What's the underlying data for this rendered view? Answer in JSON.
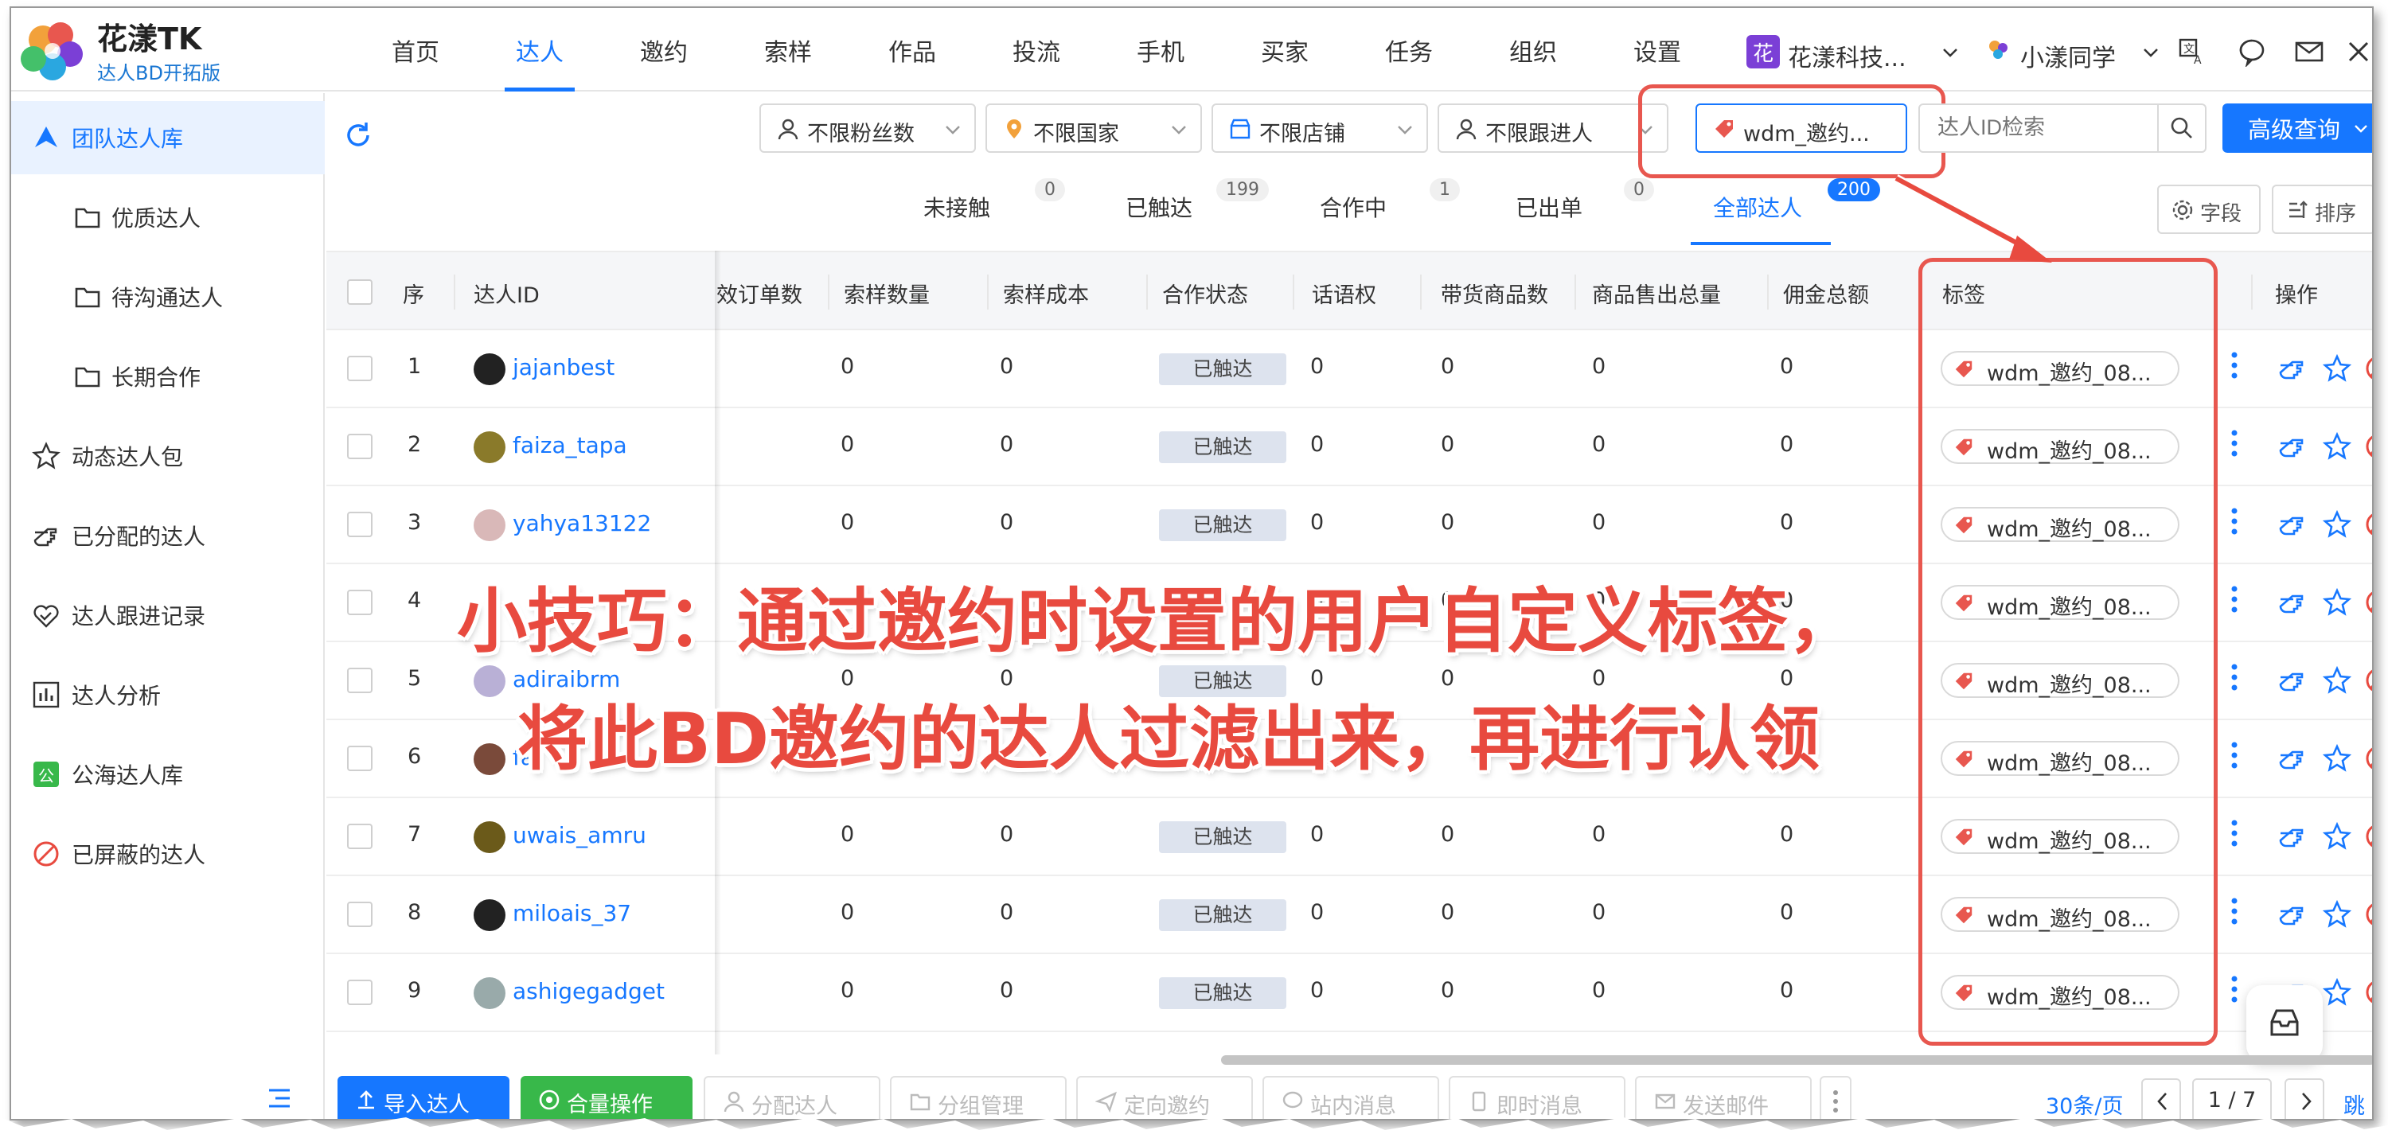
{
  "app": {
    "name": "花漾TK",
    "subtitle": "达人BD开拓版"
  },
  "nav": {
    "items": [
      "首页",
      "达人",
      "邀约",
      "索样",
      "作品",
      "投流",
      "手机",
      "买家",
      "任务",
      "组织",
      "设置"
    ],
    "active": "达人",
    "org_badge": "花",
    "org_name": "花漾科技...",
    "user_name": "小漾同学"
  },
  "sidebar": {
    "items": [
      {
        "label": "团队达人库",
        "icon": "team-library-icon",
        "active": true
      },
      {
        "label": "优质达人",
        "icon": "folder-icon",
        "active": false
      },
      {
        "label": "待沟通达人",
        "icon": "folder-icon",
        "active": false
      },
      {
        "label": "长期合作",
        "icon": "folder-icon",
        "active": false
      },
      {
        "label": "动态达人包",
        "icon": "star-icon",
        "active": false
      },
      {
        "label": "已分配的达人",
        "icon": "hand-point-icon",
        "active": false
      },
      {
        "label": "达人跟进记录",
        "icon": "heart-handshake-icon",
        "active": false
      },
      {
        "label": "达人分析",
        "icon": "bar-chart-icon",
        "active": false
      },
      {
        "label": "公海达人库",
        "icon": "public-pool-icon",
        "active": false
      },
      {
        "label": "已屏蔽的达人",
        "icon": "block-icon",
        "active": false
      }
    ]
  },
  "filters": {
    "followers": "不限粉丝数",
    "country": "不限国家",
    "shop": "不限店铺",
    "follower_person": "不限跟进人",
    "tag": "wdm_邀约...",
    "search_placeholder": "达人ID检索",
    "advanced": "高级查询"
  },
  "status_tabs": [
    {
      "label": "未接触",
      "count": "0"
    },
    {
      "label": "已触达",
      "count": "199"
    },
    {
      "label": "合作中",
      "count": "1"
    },
    {
      "label": "已出单",
      "count": "0"
    },
    {
      "label": "全部达人",
      "count": "200",
      "active": true
    }
  ],
  "view_buttons": {
    "fields": "字段",
    "sort": "排序"
  },
  "table": {
    "headers": {
      "seq": "序",
      "id": "达人ID",
      "orders": "效订单数",
      "sample_qty": "索样数量",
      "sample_cost": "索样成本",
      "coop_status": "合作状态",
      "influence": "话语权",
      "product_count": "带货商品数",
      "sales_total": "商品售出总量",
      "commission": "佣金总额",
      "tag": "标签",
      "ops": "操作"
    },
    "rows": [
      {
        "seq": "1",
        "id": "jajanbest",
        "sample_qty": "0",
        "sample_cost": "0",
        "status": "已触达",
        "influence": "0",
        "products": "0",
        "sales": "0",
        "commission": "0",
        "tag": "wdm_邀约_08..."
      },
      {
        "seq": "2",
        "id": "faiza_tapa",
        "sample_qty": "0",
        "sample_cost": "0",
        "status": "已触达",
        "influence": "0",
        "products": "0",
        "sales": "0",
        "commission": "0",
        "tag": "wdm_邀约_08..."
      },
      {
        "seq": "3",
        "id": "yahya13122",
        "sample_qty": "0",
        "sample_cost": "0",
        "status": "已触达",
        "influence": "0",
        "products": "0",
        "sales": "0",
        "commission": "0",
        "tag": "wdm_邀约_08..."
      },
      {
        "seq": "4",
        "id": "",
        "sample_qty": "",
        "sample_cost": "",
        "status": "",
        "influence": "0",
        "products": "0",
        "sales": "0",
        "commission": "0",
        "tag": "wdm_邀约_08..."
      },
      {
        "seq": "5",
        "id": "adiraibrm",
        "sample_qty": "0",
        "sample_cost": "0",
        "status": "已触达",
        "influence": "0",
        "products": "0",
        "sales": "0",
        "commission": "0",
        "tag": "wdm_邀约_08..."
      },
      {
        "seq": "6",
        "id": "fa",
        "sample_qty": "",
        "sample_cost": "",
        "status": "",
        "influence": "",
        "products": "",
        "sales": "",
        "commission": "",
        "tag": "wdm_邀约_08..."
      },
      {
        "seq": "7",
        "id": "uwais_amru",
        "sample_qty": "0",
        "sample_cost": "0",
        "status": "已触达",
        "influence": "0",
        "products": "0",
        "sales": "0",
        "commission": "0",
        "tag": "wdm_邀约_08..."
      },
      {
        "seq": "8",
        "id": "miloais_37",
        "sample_qty": "0",
        "sample_cost": "0",
        "status": "已触达",
        "influence": "0",
        "products": "0",
        "sales": "0",
        "commission": "0",
        "tag": "wdm_邀约_08..."
      },
      {
        "seq": "9",
        "id": "ashigegadget",
        "sample_qty": "0",
        "sample_cost": "0",
        "status": "已触达",
        "influence": "0",
        "products": "0",
        "sales": "0",
        "commission": "0",
        "tag": "wdm_邀约_08..."
      }
    ]
  },
  "annotation": {
    "line1": "小技巧：通过邀约时设置的用户自定义标签，",
    "line2": "将此BD邀约的达人过滤出来，再进行认领"
  },
  "bottom": {
    "import": "导入达人",
    "batch": "合量操作",
    "assign": "分配达人",
    "group": "分组管理",
    "directed_invite": "定向邀约",
    "site_message": "站内消息",
    "instant_message": "即时消息",
    "send_mail": "发送邮件",
    "page_size": "30条/页",
    "page": "1 / 7",
    "jump": "跳转"
  },
  "colors": {
    "accent": "#1677ff",
    "annotation": "#e84a3f",
    "green": "#38b84a"
  }
}
